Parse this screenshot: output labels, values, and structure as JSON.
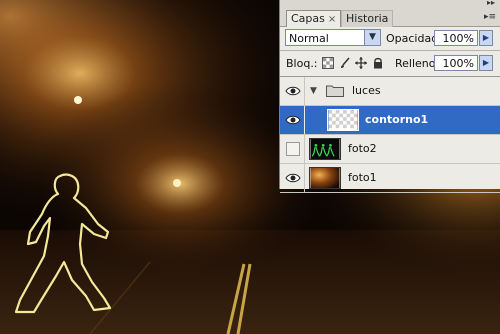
{
  "panel": {
    "tabs": [
      {
        "label": "Capas",
        "close": "×"
      },
      {
        "label": "Historia"
      }
    ],
    "blend_mode": "Normal",
    "opacity_label": "Opacidad:",
    "opacity_value": "100%",
    "lock_label": "Bloq.:",
    "fill_label": "Relleno:",
    "fill_value": "100%",
    "layers": [
      {
        "name": "luces",
        "type": "group",
        "visible": true
      },
      {
        "name": "contorno1",
        "type": "layer",
        "visible": true,
        "selected": true
      },
      {
        "name": "foto2",
        "type": "layer",
        "visible": false
      },
      {
        "name": "foto1",
        "type": "layer",
        "visible": true
      }
    ]
  },
  "icons": {
    "eye": "eye-icon",
    "lock_transparency": "checkerboard-icon",
    "lock_paint": "brush-icon",
    "lock_move": "move-icon",
    "lock_all": "padlock-icon",
    "folder": "folder-icon",
    "dropdown": "chevron-down-icon",
    "spinner": "arrow-right-icon",
    "panel_menu": "panel-menu-icon",
    "collapse": "double-arrow-icon"
  },
  "colors": {
    "selection": "#316ac5",
    "outline_glow": "#f4e89a",
    "fog": "#e8a23a"
  }
}
